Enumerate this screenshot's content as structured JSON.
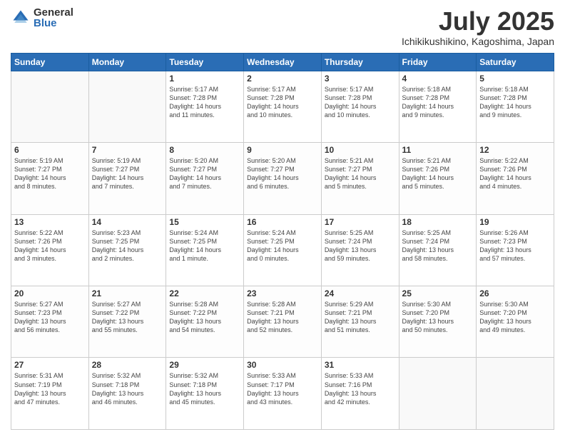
{
  "logo": {
    "general": "General",
    "blue": "Blue"
  },
  "title": {
    "month": "July 2025",
    "location": "Ichikikushikino, Kagoshima, Japan"
  },
  "weekdays": [
    "Sunday",
    "Monday",
    "Tuesday",
    "Wednesday",
    "Thursday",
    "Friday",
    "Saturday"
  ],
  "weeks": [
    [
      {
        "day": "",
        "info": ""
      },
      {
        "day": "",
        "info": ""
      },
      {
        "day": "1",
        "info": "Sunrise: 5:17 AM\nSunset: 7:28 PM\nDaylight: 14 hours\nand 11 minutes."
      },
      {
        "day": "2",
        "info": "Sunrise: 5:17 AM\nSunset: 7:28 PM\nDaylight: 14 hours\nand 10 minutes."
      },
      {
        "day": "3",
        "info": "Sunrise: 5:17 AM\nSunset: 7:28 PM\nDaylight: 14 hours\nand 10 minutes."
      },
      {
        "day": "4",
        "info": "Sunrise: 5:18 AM\nSunset: 7:28 PM\nDaylight: 14 hours\nand 9 minutes."
      },
      {
        "day": "5",
        "info": "Sunrise: 5:18 AM\nSunset: 7:28 PM\nDaylight: 14 hours\nand 9 minutes."
      }
    ],
    [
      {
        "day": "6",
        "info": "Sunrise: 5:19 AM\nSunset: 7:27 PM\nDaylight: 14 hours\nand 8 minutes."
      },
      {
        "day": "7",
        "info": "Sunrise: 5:19 AM\nSunset: 7:27 PM\nDaylight: 14 hours\nand 7 minutes."
      },
      {
        "day": "8",
        "info": "Sunrise: 5:20 AM\nSunset: 7:27 PM\nDaylight: 14 hours\nand 7 minutes."
      },
      {
        "day": "9",
        "info": "Sunrise: 5:20 AM\nSunset: 7:27 PM\nDaylight: 14 hours\nand 6 minutes."
      },
      {
        "day": "10",
        "info": "Sunrise: 5:21 AM\nSunset: 7:27 PM\nDaylight: 14 hours\nand 5 minutes."
      },
      {
        "day": "11",
        "info": "Sunrise: 5:21 AM\nSunset: 7:26 PM\nDaylight: 14 hours\nand 5 minutes."
      },
      {
        "day": "12",
        "info": "Sunrise: 5:22 AM\nSunset: 7:26 PM\nDaylight: 14 hours\nand 4 minutes."
      }
    ],
    [
      {
        "day": "13",
        "info": "Sunrise: 5:22 AM\nSunset: 7:26 PM\nDaylight: 14 hours\nand 3 minutes."
      },
      {
        "day": "14",
        "info": "Sunrise: 5:23 AM\nSunset: 7:25 PM\nDaylight: 14 hours\nand 2 minutes."
      },
      {
        "day": "15",
        "info": "Sunrise: 5:24 AM\nSunset: 7:25 PM\nDaylight: 14 hours\nand 1 minute."
      },
      {
        "day": "16",
        "info": "Sunrise: 5:24 AM\nSunset: 7:25 PM\nDaylight: 14 hours\nand 0 minutes."
      },
      {
        "day": "17",
        "info": "Sunrise: 5:25 AM\nSunset: 7:24 PM\nDaylight: 13 hours\nand 59 minutes."
      },
      {
        "day": "18",
        "info": "Sunrise: 5:25 AM\nSunset: 7:24 PM\nDaylight: 13 hours\nand 58 minutes."
      },
      {
        "day": "19",
        "info": "Sunrise: 5:26 AM\nSunset: 7:23 PM\nDaylight: 13 hours\nand 57 minutes."
      }
    ],
    [
      {
        "day": "20",
        "info": "Sunrise: 5:27 AM\nSunset: 7:23 PM\nDaylight: 13 hours\nand 56 minutes."
      },
      {
        "day": "21",
        "info": "Sunrise: 5:27 AM\nSunset: 7:22 PM\nDaylight: 13 hours\nand 55 minutes."
      },
      {
        "day": "22",
        "info": "Sunrise: 5:28 AM\nSunset: 7:22 PM\nDaylight: 13 hours\nand 54 minutes."
      },
      {
        "day": "23",
        "info": "Sunrise: 5:28 AM\nSunset: 7:21 PM\nDaylight: 13 hours\nand 52 minutes."
      },
      {
        "day": "24",
        "info": "Sunrise: 5:29 AM\nSunset: 7:21 PM\nDaylight: 13 hours\nand 51 minutes."
      },
      {
        "day": "25",
        "info": "Sunrise: 5:30 AM\nSunset: 7:20 PM\nDaylight: 13 hours\nand 50 minutes."
      },
      {
        "day": "26",
        "info": "Sunrise: 5:30 AM\nSunset: 7:20 PM\nDaylight: 13 hours\nand 49 minutes."
      }
    ],
    [
      {
        "day": "27",
        "info": "Sunrise: 5:31 AM\nSunset: 7:19 PM\nDaylight: 13 hours\nand 47 minutes."
      },
      {
        "day": "28",
        "info": "Sunrise: 5:32 AM\nSunset: 7:18 PM\nDaylight: 13 hours\nand 46 minutes."
      },
      {
        "day": "29",
        "info": "Sunrise: 5:32 AM\nSunset: 7:18 PM\nDaylight: 13 hours\nand 45 minutes."
      },
      {
        "day": "30",
        "info": "Sunrise: 5:33 AM\nSunset: 7:17 PM\nDaylight: 13 hours\nand 43 minutes."
      },
      {
        "day": "31",
        "info": "Sunrise: 5:33 AM\nSunset: 7:16 PM\nDaylight: 13 hours\nand 42 minutes."
      },
      {
        "day": "",
        "info": ""
      },
      {
        "day": "",
        "info": ""
      }
    ]
  ]
}
